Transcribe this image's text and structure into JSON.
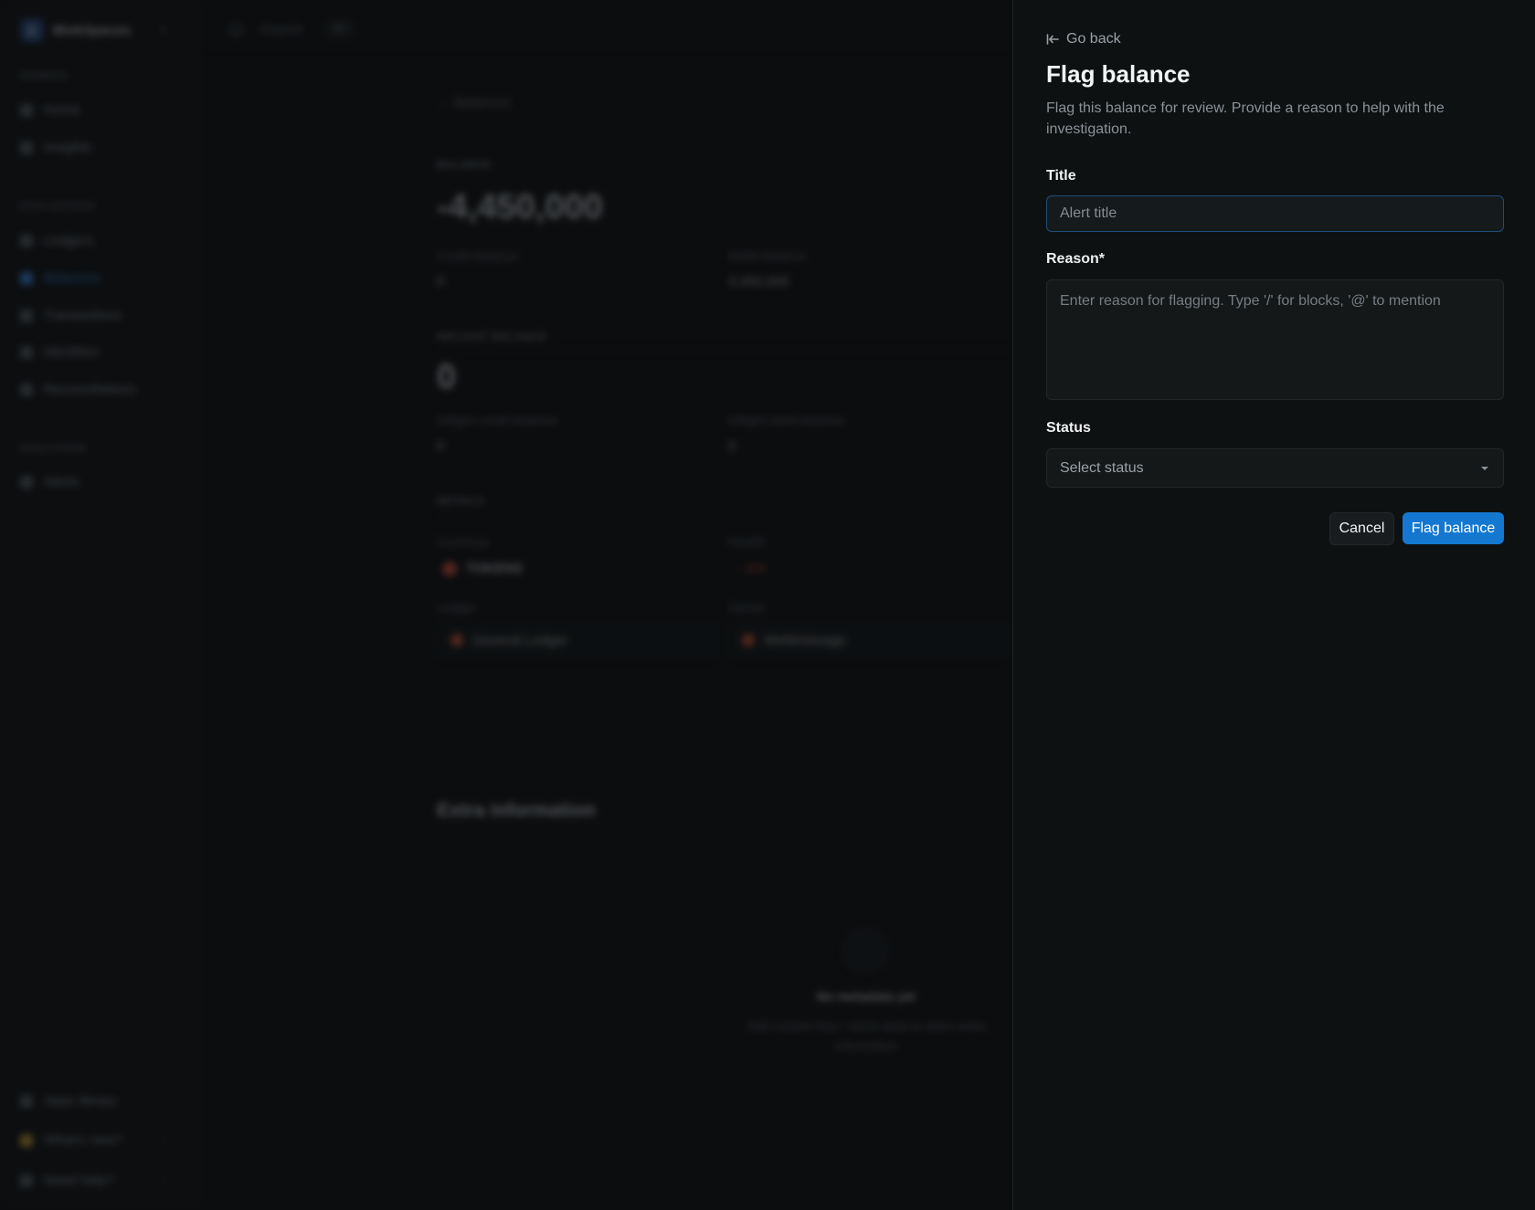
{
  "background": {
    "workspace": {
      "initial": "B",
      "name": "BlnkSpaces"
    },
    "sidebar": {
      "sections": [
        {
          "label": "GENERAL",
          "items": [
            "Home",
            "Insights"
          ]
        },
        {
          "label": "DATA ENTRIES",
          "items": [
            "Ledgers",
            "Balances",
            "Transactions",
            "Identities",
            "Reconciliations"
          ]
        },
        {
          "label": "MONITORING",
          "items": [
            "Alerts"
          ]
        }
      ],
      "active_item": "Balances",
      "footer": [
        "Apps library",
        "What's new?",
        "Need help?"
      ]
    },
    "topbar": {
      "search_placeholder": "Search",
      "shortcut": "⌘K"
    },
    "breadcrumb": "Balances",
    "balance": {
      "section_label": "BALANCE",
      "value": "-4,450,000",
      "credit_label": "Credit balance",
      "credit_value": "0",
      "debit_label": "Debit balance",
      "debit_value": "4,450,000"
    },
    "inflight": {
      "section_label": "INFLIGHT BALANCE",
      "value": "0",
      "credit_label": "Inflight credit balance",
      "credit_value": "0",
      "debit_label": "Inflight debit balance",
      "debit_value": "0"
    },
    "details": {
      "section_label": "DETAILS",
      "currency_label": "Currency",
      "currency_value": "TOKENS",
      "health_label": "Health",
      "health_value": "↓ 100",
      "ledger_label": "Ledger",
      "ledger_value": "General Ledger",
      "owner_label": "Owner",
      "owner_value": "WebbVenage"
    },
    "extra": {
      "title": "Extra information",
      "empty_title": "No metadata yet",
      "empty_sub": "Add custom key / value data to store extra information"
    }
  },
  "drawer": {
    "go_back": "Go back",
    "title": "Flag balance",
    "description": "Flag this balance for review. Provide a reason to help with the investigation.",
    "title_field": {
      "label": "Title",
      "placeholder": "Alert title",
      "value": ""
    },
    "reason_field": {
      "label": "Reason*",
      "placeholder": "Enter reason for flagging. Type '/' for blocks, '@' to mention",
      "value": ""
    },
    "status_field": {
      "label": "Status",
      "selected": "Select status"
    },
    "cancel_label": "Cancel",
    "submit_label": "Flag balance",
    "accent_color": "#1478d0"
  }
}
